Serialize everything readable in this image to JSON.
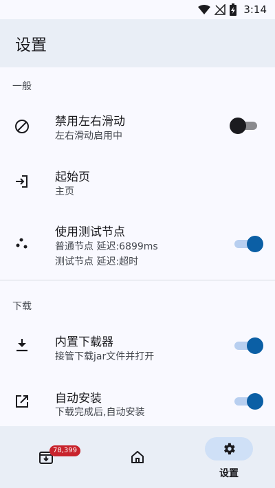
{
  "status_bar": {
    "time": "3:14"
  },
  "app_bar": {
    "title": "设置"
  },
  "sections": {
    "general": {
      "header": "一般",
      "items": [
        {
          "title": "禁用左右滑动",
          "subtitle": "左右滑动启用中",
          "toggle": "off",
          "icon": "block-icon"
        },
        {
          "title": "起始页",
          "subtitle": "主页",
          "icon": "login-icon"
        },
        {
          "title": "使用测试节点",
          "subtitle1": "普通节点 延迟:6899ms",
          "subtitle2": "测试节点 延迟:超时",
          "toggle": "on",
          "icon": "nodes-icon"
        }
      ]
    },
    "download": {
      "header": "下载",
      "items": [
        {
          "title": "内置下载器",
          "subtitle": "接管下载jar文件并打开",
          "toggle": "on",
          "icon": "download-icon"
        },
        {
          "title": "自动安装",
          "subtitle": "下载完成后,自动安装",
          "toggle": "on",
          "icon": "open-external-icon"
        }
      ]
    }
  },
  "bottom_nav": {
    "downloads_badge": "78,399",
    "settings_label": "设置",
    "selected": "settings"
  },
  "colors": {
    "accent": "#0b5fa5",
    "app_bar_bg": "#e9eef6",
    "badge": "#c8232c"
  }
}
